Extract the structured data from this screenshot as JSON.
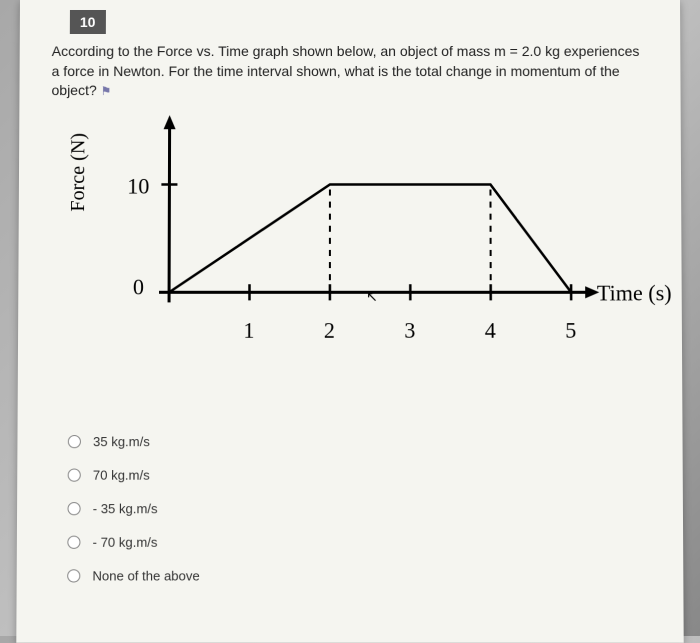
{
  "question_number": "10",
  "question_text": "According to the Force vs. Time graph shown below, an object of mass m = 2.0 kg experiences a force in Newton. For the time interval shown, what is the total change in momentum of the object?",
  "chart_data": {
    "type": "line",
    "title": "",
    "xlabel": "Time (s)",
    "ylabel": "Force (N)",
    "xlim": [
      0,
      5.5
    ],
    "ylim": [
      0,
      12
    ],
    "xticks": [
      "1",
      "2",
      "3",
      "4",
      "5"
    ],
    "yticks": [
      "10"
    ],
    "origin": "0",
    "series": [
      {
        "name": "Force",
        "x": [
          0,
          2,
          4,
          5
        ],
        "y": [
          0,
          10,
          10,
          0
        ]
      }
    ],
    "dashed_verticals_x": [
      2,
      4
    ]
  },
  "options": [
    {
      "label": "35 kg.m/s"
    },
    {
      "label": "70 kg.m/s"
    },
    {
      "label": "- 35 kg.m/s"
    },
    {
      "label": "- 70 kg.m/s"
    },
    {
      "label": "None of the above"
    }
  ]
}
